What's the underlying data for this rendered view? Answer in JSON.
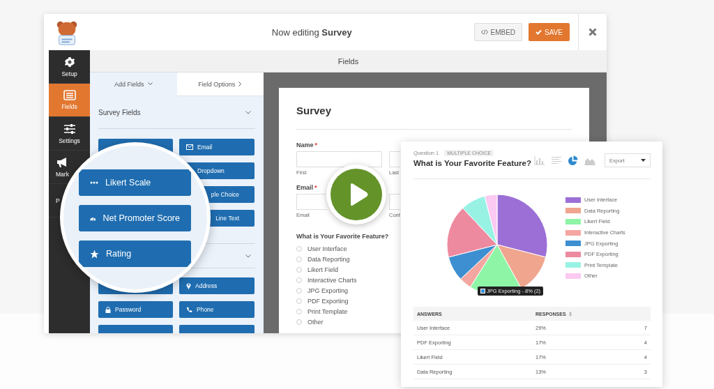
{
  "window": {
    "title": "Now editing **Survey**",
    "buttons": [
      {
        "kind": "embed",
        "label": "EMBED"
      },
      {
        "kind": "save",
        "label": "SAVE"
      }
    ]
  },
  "sidebar": {
    "items": [
      {
        "kind": "gear",
        "label": "Setup",
        "selected": false
      },
      {
        "kind": "list",
        "label": "Fields",
        "selected": true
      },
      {
        "kind": "sliders",
        "label": "Settings",
        "selected": false
      },
      {
        "kind": "megaphone",
        "label": "Mark",
        "selected": false
      },
      {
        "kind": "none",
        "label": "P",
        "selected": false
      }
    ]
  },
  "fields_bar": {
    "title": "Fields"
  },
  "panel": {
    "tabs": [
      {
        "kind": "down",
        "label": "Add Fields",
        "selected": true
      },
      {
        "kind": "right",
        "label": "Field Options",
        "selected": false
      }
    ],
    "sections": [
      {
        "title": "Survey Fields",
        "expanded": true,
        "buttons": [
          {
            "kind": "blank"
          },
          {
            "kind": "email",
            "label": "Email"
          },
          {
            "kind": "covered",
            "label": "Dropdown"
          },
          {
            "kind": "cut",
            "label": "ple Choice"
          },
          {
            "kind": "cut",
            "label": "Line Text"
          }
        ]
      },
      {
        "expanded": true,
        "buttons": [
          {
            "kind": "blank"
          },
          {
            "kind": "pin",
            "label": "Address"
          },
          {
            "kind": "lock",
            "label": "Password"
          },
          {
            "kind": "phone",
            "label": "Phone"
          },
          {
            "kind": "blank"
          },
          {
            "kind": "blank"
          }
        ]
      }
    ]
  },
  "magnifier": {
    "buttons": [
      {
        "kind": "dots",
        "label": "Likert Scale"
      },
      {
        "kind": "gauge",
        "label": "Net Promoter Score"
      },
      {
        "kind": "star",
        "label": "Rating"
      }
    ]
  },
  "form": {
    "title": "Survey",
    "fields": [
      {
        "label": "Name",
        "mark": "*",
        "sublabels": [
          "First",
          "Last"
        ]
      },
      {
        "label": "Email",
        "mark": "*",
        "sublabels": [
          "Email",
          "Conf"
        ]
      }
    ],
    "question": "What is Your Favorite Feature?",
    "options": [
      {
        "label": "User Interface",
        "selected": false
      },
      {
        "label": "Data Reporting",
        "selected": false
      },
      {
        "label": "Likert Field",
        "selected": false
      },
      {
        "label": "Interactive Charts",
        "selected": false
      },
      {
        "label": "JPG Exporting",
        "selected": false
      },
      {
        "label": "PDF Exporting",
        "selected": false
      },
      {
        "label": "Print Template",
        "selected": false
      },
      {
        "label": "Other",
        "selected": false
      }
    ]
  },
  "report": {
    "question_number": "Question 1",
    "type_badge": "MULTIPLE CHOICE",
    "title": "What is Your Favorite Feature?",
    "chart_views": [
      {
        "kind": "bar",
        "selected": false
      },
      {
        "kind": "lines",
        "selected": false
      },
      {
        "kind": "pie",
        "selected": true
      },
      {
        "kind": "area",
        "selected": false
      }
    ],
    "export": "Export",
    "chart_data": {
      "type": "pie",
      "legend": "right",
      "categories": [
        "User Interface",
        "Data Reporting",
        "Likert Field",
        "Interactive Charts",
        "JPG Exporting",
        "PDF Exporting",
        "Print Template",
        "Other"
      ],
      "values": [
        29,
        13,
        17,
        4,
        8,
        17,
        8,
        4
      ],
      "colors": [
        "#9b6fd6",
        "#f0a58f",
        "#8ef5a6",
        "#f4a6a0",
        "#3d8fd1",
        "#ee8aa0",
        "#98f2e4",
        "#fbc9f1"
      ]
    },
    "tooltip": "JPG Exporting - 8% (2)",
    "table": {
      "columns": [
        "ANSWERS",
        "RESPONSES"
      ],
      "rows": [
        [
          "User Interface",
          "29%",
          "7"
        ],
        [
          "PDF Exporting",
          "17%",
          "4"
        ],
        [
          "Likert Field",
          "17%",
          "4"
        ],
        [
          "Data Reporting",
          "13%",
          "3"
        ]
      ]
    }
  }
}
